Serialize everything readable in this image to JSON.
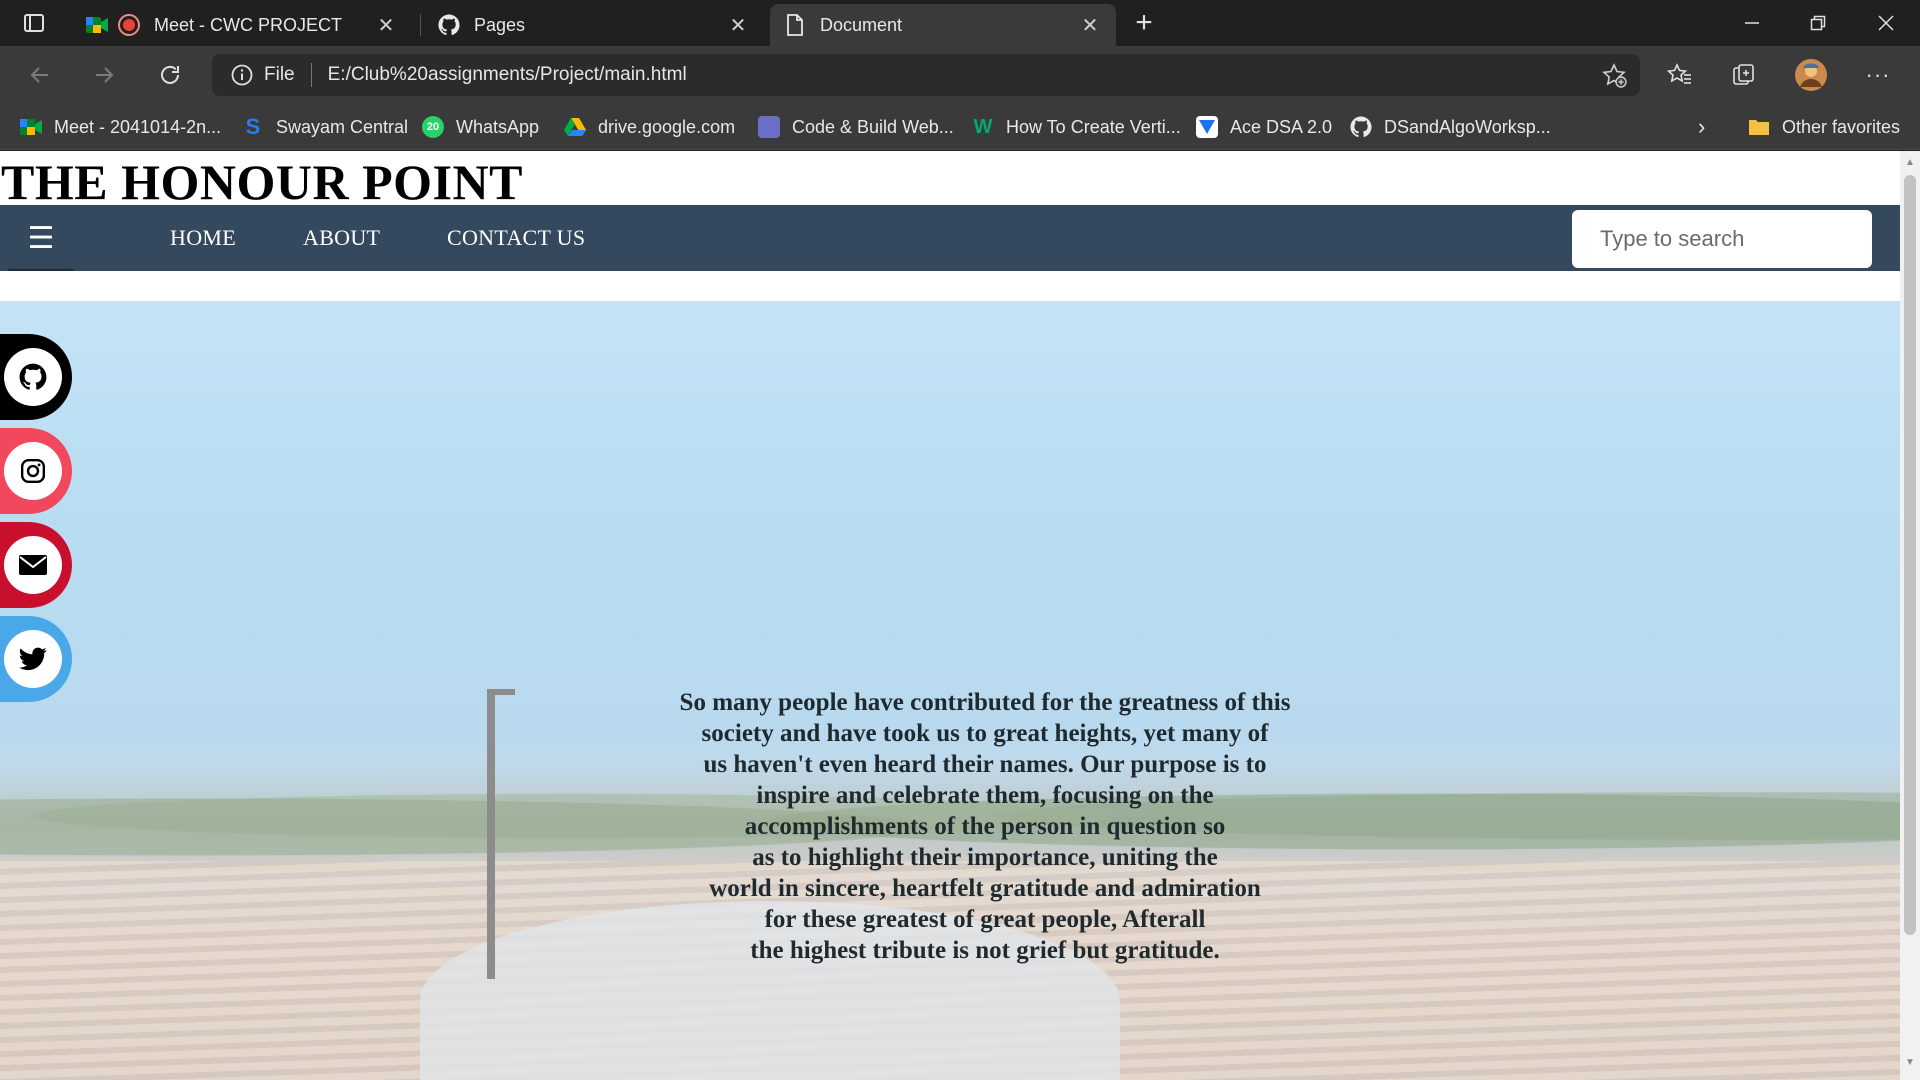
{
  "tabs": [
    {
      "title": "Meet - CWC PROJECT",
      "active": false
    },
    {
      "title": "Pages",
      "active": false
    },
    {
      "title": "Document",
      "active": true
    }
  ],
  "address": {
    "scheme": "File",
    "url": "E:/Club%20assignments/Project/main.html"
  },
  "bookmarks": [
    {
      "label": "Meet - 2041014-2n...",
      "icon": "google-meet-icon"
    },
    {
      "label": "Swayam Central",
      "icon": "swayam-icon"
    },
    {
      "label": "WhatsApp",
      "icon": "whatsapp-icon"
    },
    {
      "label": "drive.google.com",
      "icon": "google-drive-icon"
    },
    {
      "label": "Code & Build Web...",
      "icon": "code-build-icon"
    },
    {
      "label": "How To Create Verti...",
      "icon": "w3schools-icon"
    },
    {
      "label": "Ace DSA 2.0",
      "icon": "ace-dsa-icon"
    },
    {
      "label": "DSandAlgoWorksp...",
      "icon": "github-icon"
    }
  ],
  "other_favorites": "Other favorites",
  "site": {
    "title": "THE HONOUR POINT",
    "nav": [
      "HOME",
      "ABOUT",
      "CONTACT US"
    ],
    "search_placeholder": "Type to search",
    "hero_lines": [
      "So many people have contributed for the greatness of this",
      "society and have took us to great heights, yet many of",
      "us haven't even heard their names. Our purpose is to",
      "inspire and celebrate them, focusing on the",
      "accomplishments of the person in question so",
      "as to highlight their importance, uniting the",
      "world in sincere, heartfelt gratitude and admiration",
      "for these greatest of great people, Afterall",
      "the highest tribute is not grief but gratitude."
    ],
    "social": [
      {
        "name": "github",
        "color": "#000000"
      },
      {
        "name": "instagram",
        "color": "#f2485e"
      },
      {
        "name": "email",
        "color": "#c8102e"
      },
      {
        "name": "twitter",
        "color": "#4aa8e8"
      }
    ]
  },
  "colors": {
    "navbar": "#34495e",
    "chrome_dark": "#202020",
    "chrome_mid": "#3a3a3a"
  }
}
